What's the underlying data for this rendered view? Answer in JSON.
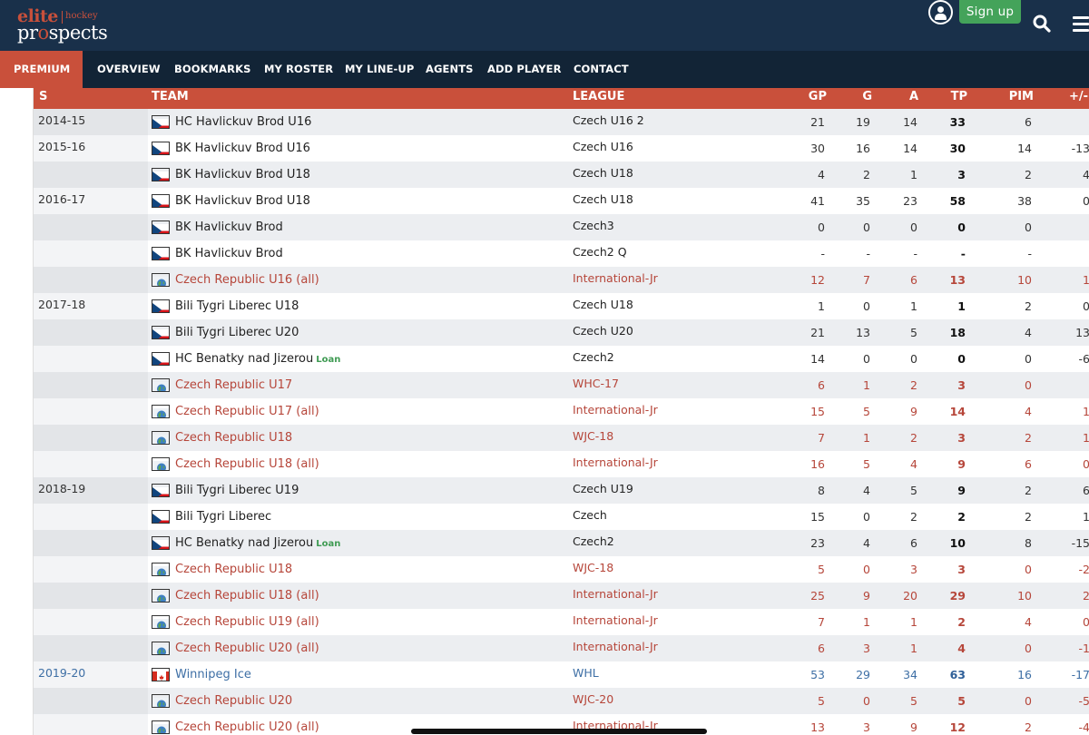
{
  "brand": {
    "word1": "elite",
    "word2": "hockey",
    "word3a": "pr",
    "word3b": "o",
    "word3c": "spects"
  },
  "header": {
    "signup_label": "Sign up",
    "icons": [
      "user-icon",
      "search-icon",
      "menu-icon"
    ]
  },
  "nav": {
    "items": [
      "PREMIUM",
      "OVERVIEW",
      "BOOKMARKS",
      "MY ROSTER",
      "MY LINE-UP",
      "AGENTS",
      "ADD PLAYER",
      "CONTACT"
    ],
    "active_color": "#c9503b"
  },
  "table": {
    "columns": [
      "S",
      "TEAM",
      "LEAGUE",
      "GP",
      "G",
      "A",
      "TP",
      "PIM",
      "+/-"
    ],
    "accent_color": "#c9503b",
    "intl_color": "#b6463a",
    "nhl_color": "#3e6fa5",
    "loan_color": "#3f9b53",
    "rows": [
      {
        "season": "2014-15",
        "team": "HC Havlickuv Brod U16",
        "flag": "czech",
        "type": "club",
        "loan": "",
        "league": "Czech U16 2",
        "gp": "21",
        "g": "19",
        "a": "14",
        "tp": "33",
        "pim": "6",
        "pm": ""
      },
      {
        "season": "2015-16",
        "team": "BK Havlickuv Brod U16",
        "flag": "czech",
        "type": "club",
        "loan": "",
        "league": "Czech U16",
        "gp": "30",
        "g": "16",
        "a": "14",
        "tp": "30",
        "pim": "14",
        "pm": "-13"
      },
      {
        "season": "",
        "team": "BK Havlickuv Brod U18",
        "flag": "czech",
        "type": "club",
        "loan": "",
        "league": "Czech U18",
        "gp": "4",
        "g": "2",
        "a": "1",
        "tp": "3",
        "pim": "2",
        "pm": "4"
      },
      {
        "season": "2016-17",
        "team": "BK Havlickuv Brod U18",
        "flag": "czech",
        "type": "club",
        "loan": "",
        "league": "Czech U18",
        "gp": "41",
        "g": "35",
        "a": "23",
        "tp": "58",
        "pim": "38",
        "pm": "0"
      },
      {
        "season": "",
        "team": "BK Havlickuv Brod",
        "flag": "czech",
        "type": "club",
        "loan": "",
        "league": "Czech3",
        "gp": "0",
        "g": "0",
        "a": "0",
        "tp": "0",
        "pim": "0",
        "pm": ""
      },
      {
        "season": "",
        "team": "BK Havlickuv Brod",
        "flag": "czech",
        "type": "club",
        "loan": "",
        "league": "Czech2 Q",
        "gp": "-",
        "g": "-",
        "a": "-",
        "tp": "-",
        "pim": "-",
        "pm": ""
      },
      {
        "season": "",
        "team": "Czech Republic U16 (all)",
        "flag": "globe",
        "type": "intl",
        "loan": "",
        "league": "International-Jr",
        "gp": "12",
        "g": "7",
        "a": "6",
        "tp": "13",
        "pim": "10",
        "pm": "1"
      },
      {
        "season": "2017-18",
        "team": "Bili Tygri Liberec U18",
        "flag": "czech",
        "type": "club",
        "loan": "",
        "league": "Czech U18",
        "gp": "1",
        "g": "0",
        "a": "1",
        "tp": "1",
        "pim": "2",
        "pm": "0"
      },
      {
        "season": "",
        "team": "Bili Tygri Liberec U20",
        "flag": "czech",
        "type": "club",
        "loan": "",
        "league": "Czech U20",
        "gp": "21",
        "g": "13",
        "a": "5",
        "tp": "18",
        "pim": "4",
        "pm": "13"
      },
      {
        "season": "",
        "team": "HC Benatky nad Jizerou",
        "flag": "czech",
        "type": "club",
        "loan": "Loan",
        "league": "Czech2",
        "gp": "14",
        "g": "0",
        "a": "0",
        "tp": "0",
        "pim": "0",
        "pm": "-6"
      },
      {
        "season": "",
        "team": "Czech Republic U17",
        "flag": "globe",
        "type": "intl",
        "loan": "",
        "league": "WHC-17",
        "gp": "6",
        "g": "1",
        "a": "2",
        "tp": "3",
        "pim": "0",
        "pm": ""
      },
      {
        "season": "",
        "team": "Czech Republic U17 (all)",
        "flag": "globe",
        "type": "intl",
        "loan": "",
        "league": "International-Jr",
        "gp": "15",
        "g": "5",
        "a": "9",
        "tp": "14",
        "pim": "4",
        "pm": "1"
      },
      {
        "season": "",
        "team": "Czech Republic U18",
        "flag": "globe",
        "type": "intl",
        "loan": "",
        "league": "WJC-18",
        "gp": "7",
        "g": "1",
        "a": "2",
        "tp": "3",
        "pim": "2",
        "pm": "1"
      },
      {
        "season": "",
        "team": "Czech Republic U18 (all)",
        "flag": "globe",
        "type": "intl",
        "loan": "",
        "league": "International-Jr",
        "gp": "16",
        "g": "5",
        "a": "4",
        "tp": "9",
        "pim": "6",
        "pm": "0"
      },
      {
        "season": "2018-19",
        "team": "Bili Tygri Liberec U19",
        "flag": "czech",
        "type": "club",
        "loan": "",
        "league": "Czech U19",
        "gp": "8",
        "g": "4",
        "a": "5",
        "tp": "9",
        "pim": "2",
        "pm": "6"
      },
      {
        "season": "",
        "team": "Bili Tygri Liberec",
        "flag": "czech",
        "type": "club",
        "loan": "",
        "league": "Czech",
        "gp": "15",
        "g": "0",
        "a": "2",
        "tp": "2",
        "pim": "2",
        "pm": "1"
      },
      {
        "season": "",
        "team": "HC Benatky nad Jizerou",
        "flag": "czech",
        "type": "club",
        "loan": "Loan",
        "league": "Czech2",
        "gp": "23",
        "g": "4",
        "a": "6",
        "tp": "10",
        "pim": "8",
        "pm": "-15"
      },
      {
        "season": "",
        "team": "Czech Republic U18",
        "flag": "globe",
        "type": "intl",
        "loan": "",
        "league": "WJC-18",
        "gp": "5",
        "g": "0",
        "a": "3",
        "tp": "3",
        "pim": "0",
        "pm": "-2"
      },
      {
        "season": "",
        "team": "Czech Republic U18 (all)",
        "flag": "globe",
        "type": "intl",
        "loan": "",
        "league": "International-Jr",
        "gp": "25",
        "g": "9",
        "a": "20",
        "tp": "29",
        "pim": "10",
        "pm": "2"
      },
      {
        "season": "",
        "team": "Czech Republic U19 (all)",
        "flag": "globe",
        "type": "intl",
        "loan": "",
        "league": "International-Jr",
        "gp": "7",
        "g": "1",
        "a": "1",
        "tp": "2",
        "pim": "4",
        "pm": "0"
      },
      {
        "season": "",
        "team": "Czech Republic U20 (all)",
        "flag": "globe",
        "type": "intl",
        "loan": "",
        "league": "International-Jr",
        "gp": "6",
        "g": "3",
        "a": "1",
        "tp": "4",
        "pim": "0",
        "pm": "-1"
      },
      {
        "season": "2019-20",
        "team": "Winnipeg Ice",
        "flag": "canada",
        "type": "nhl",
        "loan": "",
        "league": "WHL",
        "gp": "53",
        "g": "29",
        "a": "34",
        "tp": "63",
        "pim": "16",
        "pm": "-17"
      },
      {
        "season": "",
        "team": "Czech Republic U20",
        "flag": "globe",
        "type": "intl",
        "loan": "",
        "league": "WJC-20",
        "gp": "5",
        "g": "0",
        "a": "5",
        "tp": "5",
        "pim": "0",
        "pm": "-5"
      },
      {
        "season": "",
        "team": "Czech Republic U20 (all)",
        "flag": "globe",
        "type": "intl",
        "loan": "",
        "league": "International-Jr",
        "gp": "13",
        "g": "3",
        "a": "9",
        "tp": "12",
        "pim": "2",
        "pm": "-4"
      }
    ]
  }
}
